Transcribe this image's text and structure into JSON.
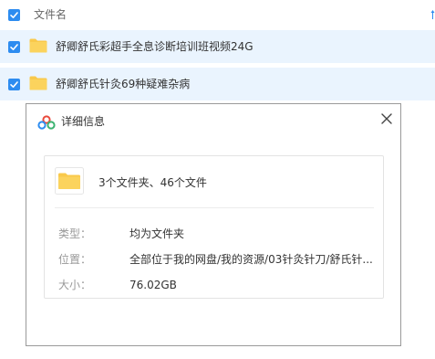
{
  "file_list": {
    "header": {
      "column_label": "文件名"
    },
    "rows": [
      {
        "name": "舒卿舒氏彩超手全息诊断培训班视频24G",
        "checked": true
      },
      {
        "name": "舒卿舒氏针灸69种疑难杂病",
        "checked": true
      }
    ]
  },
  "dialog": {
    "title": "详细信息",
    "summary": "3个文件夹、46个文件",
    "fields": {
      "type_label": "类型：",
      "type_value": "均为文件夹",
      "location_label": "位置：",
      "location_value": "全部位于我的网盘/我的资源/03针灸针刀/舒氏针...",
      "size_label": "大小：",
      "size_value": "76.02GB"
    }
  },
  "icons": {
    "checkbox": "checkbox-checked-icon",
    "folder": "folder-icon",
    "cloud": "baidu-cloud-icon",
    "close": "close-icon",
    "sort": "sort-arrow-icon"
  },
  "colors": {
    "accent": "#2d8cf0",
    "row_selected_bg": "#eaf4fe",
    "folder": "#f9c94b",
    "label": "#999999"
  }
}
